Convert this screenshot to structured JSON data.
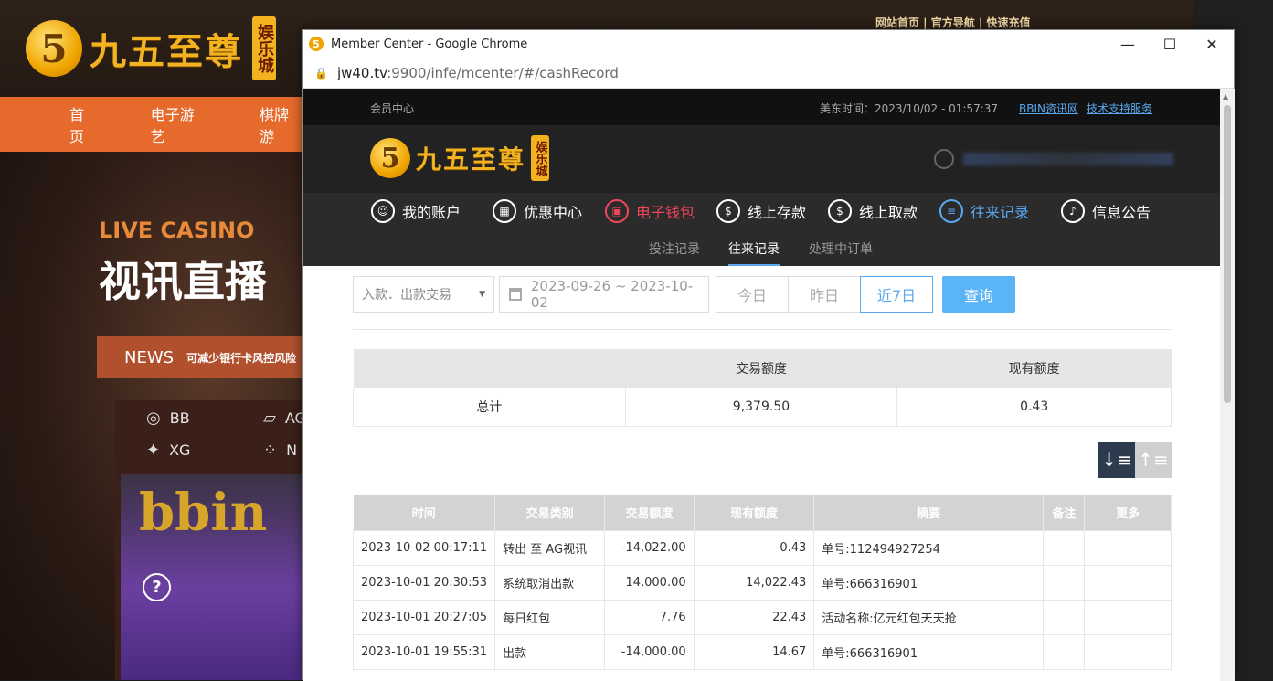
{
  "background_site": {
    "logo_text": "九五至尊",
    "logo_badge": "娱乐城",
    "top_links": "网站首页 | 官方导航 | 快速充值",
    "nav": [
      "首页",
      "电子游艺",
      "棋牌游"
    ],
    "live_casino": "LIVE CASINO",
    "live_casino_cn": "视讯直播",
    "news_label": "NEWS",
    "news_text": "可减少银行卡风控风险",
    "games": [
      "BB",
      "AG",
      "XG",
      "N"
    ],
    "bbin_logo": "bbin",
    "help_glyph": "?"
  },
  "window": {
    "title": "Member Center - Google Chrome",
    "url_host": "jw40.tv",
    "url_rest": ":9900/infe/mcenter/#/cashRecord",
    "controls": {
      "minimize": "—",
      "maximize": "☐",
      "close": "✕"
    }
  },
  "member_center": {
    "top": {
      "member_label": "会员中心",
      "time": "美东时间：2023/10/02 - 01:57:37",
      "link_news": "BBIN资讯网",
      "link_support": "技术支持服务"
    },
    "logo_text": "九五至尊",
    "logo_badge": "娱乐城",
    "nav": [
      {
        "label": "我的账户",
        "icon": "user-icon",
        "glyph": ""
      },
      {
        "label": "优惠中心",
        "icon": "gift-icon",
        "glyph": ""
      },
      {
        "label": "电子钱包",
        "icon": "wallet-icon",
        "glyph": ""
      },
      {
        "label": "线上存款",
        "icon": "deposit-icon",
        "glyph": ""
      },
      {
        "label": "线上取款",
        "icon": "withdraw-icon",
        "glyph": ""
      },
      {
        "label": "往来记录",
        "icon": "records-icon",
        "glyph": ""
      },
      {
        "label": "信息公告",
        "icon": "bell-icon",
        "glyph": ""
      }
    ],
    "subnav": [
      "投注记录",
      "往来记录",
      "处理中订单"
    ],
    "filters": {
      "type_select": "入款．出款交易",
      "date_range": "2023-09-26 ~ 2023-10-02",
      "today": "今日",
      "yesterday": "昨日",
      "last7": "近7日",
      "query": "查询"
    },
    "summary": {
      "headers": [
        "",
        "交易额度",
        "现有额度"
      ],
      "row": [
        "总计",
        "9,379.50",
        "0.43"
      ]
    },
    "records": {
      "headers": [
        "时间",
        "交易类别",
        "交易额度",
        "现有额度",
        "摘要",
        "备注",
        "更多"
      ],
      "rows": [
        [
          "2023-10-02 00:17:11",
          "转出 至 AG视讯",
          "-14,022.00",
          "0.43",
          "单号:112494927254",
          "",
          ""
        ],
        [
          "2023-10-01 20:30:53",
          "系统取消出款",
          "14,000.00",
          "14,022.43",
          "单号:666316901",
          "",
          ""
        ],
        [
          "2023-10-01 20:27:05",
          "每日红包",
          "7.76",
          "22.43",
          "活动名称:亿元红包天天抢",
          "",
          ""
        ],
        [
          "2023-10-01 19:55:31",
          "出款",
          "-14,000.00",
          "14.67",
          "单号:666316901",
          "",
          ""
        ]
      ]
    }
  },
  "colors": {
    "accent_blue": "#5aa9f0",
    "accent_red": "#f0465c",
    "gold": "#f3b321",
    "nav_orange": "#e56a2c"
  }
}
